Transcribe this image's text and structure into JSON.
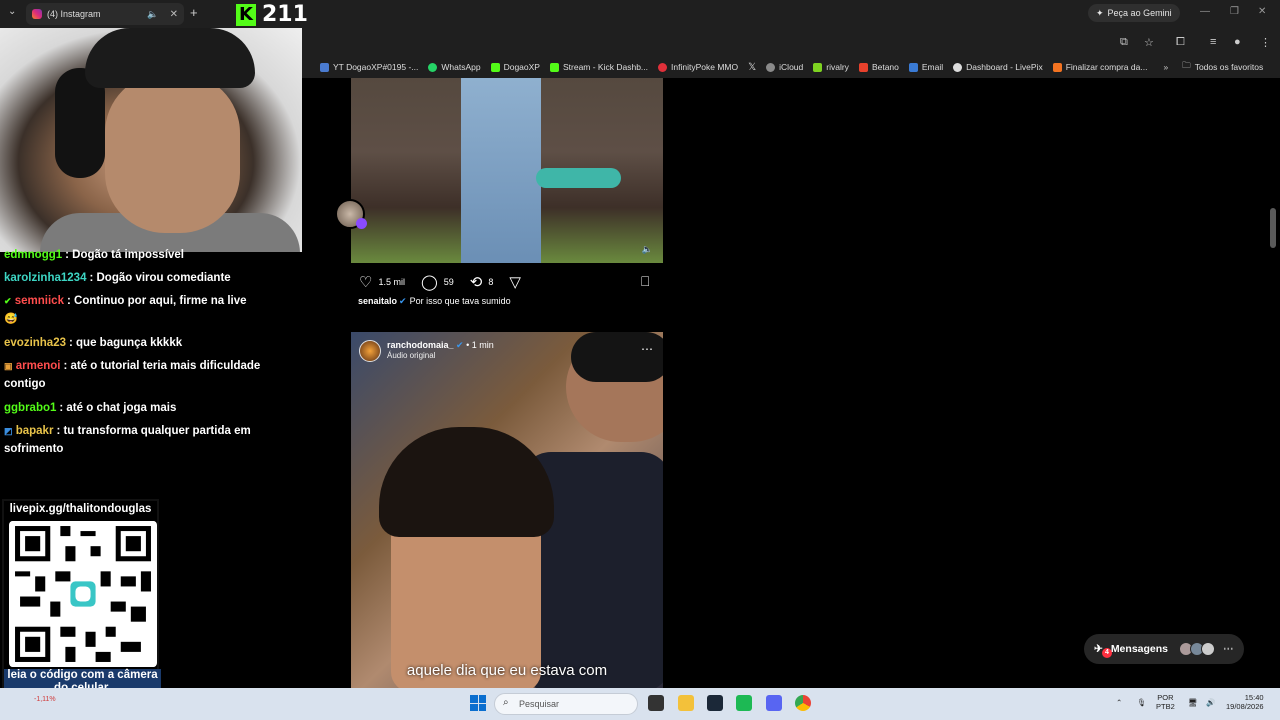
{
  "browser": {
    "tab_title": "(4) Instagram",
    "gemini_button": "Peça ao Gemini",
    "bookmarks": [
      {
        "label": "YT DogaoXP#0195 -...",
        "color": "#4a7bd0"
      },
      {
        "label": "WhatsApp",
        "color": "#25d366"
      },
      {
        "label": "DogaoXP",
        "color": "#53fc18"
      },
      {
        "label": "Stream - Kick Dashb...",
        "color": "#53fc18"
      },
      {
        "label": "InfinityPoke MMO",
        "color": "#e0303a"
      },
      {
        "label": "X",
        "color": "#ffffff"
      },
      {
        "label": "iCloud",
        "color": "#8a8a8a"
      },
      {
        "label": "rivalry",
        "color": "#7ed321"
      },
      {
        "label": "Betano",
        "color": "#e8412c"
      },
      {
        "label": "Email",
        "color": "#3a7bd5"
      },
      {
        "label": "Dashboard - LivePix",
        "color": "#dddddd"
      },
      {
        "label": "Finalizar compra da...",
        "color": "#f37321"
      }
    ],
    "all_favorites": "Todos os favoritos"
  },
  "kick_overlay": {
    "viewers": "211"
  },
  "chat": {
    "messages": [
      {
        "user": "edmnogg1",
        "text": ": Dogão tá impossível",
        "color": "#53fc18"
      },
      {
        "user": "karolzinha1234",
        "text": ": Dogão virou comediante",
        "color": "#3dd6c4"
      },
      {
        "user": "semniick",
        "text": ": Continuo por aqui, firme na live",
        "color": "#ff4d4d"
      },
      {
        "user": "evozinha23",
        "text": ": que bagunça kkkkk",
        "color": "#e8c34a"
      },
      {
        "user": "armenoi",
        "text": ": até o tutorial teria mais dificuldade contigo",
        "color": "#ff4d4d"
      },
      {
        "user": "ggbrabo1",
        "text": ": até o chat joga mais",
        "color": "#53fc18"
      },
      {
        "user": "bapakr",
        "text": ": tu transforma qualquer partida em sofrimento",
        "color": "#e8c34a"
      }
    ]
  },
  "qr": {
    "url": "livepix.gg/thalitondouglas",
    "caption": "leia o código com a câmera do celular."
  },
  "post1": {
    "likes": "1.5 mil",
    "comments": "59",
    "reposts": "8",
    "caption_user": "senaitalo",
    "caption_text": "Por isso que tava sumido"
  },
  "post2": {
    "user": "ranchodomaia_",
    "time": "1 min",
    "audio": "Áudio original",
    "subtitle": "aquele dia que eu estava com"
  },
  "messages_button": {
    "label": "Mensagens",
    "badge": "4"
  },
  "taskbar": {
    "search_placeholder": "Pesquisar",
    "stock": "-1,11%",
    "lang": "POR",
    "layout": "PTB2",
    "time": "15:40",
    "date": "19/08/2026"
  }
}
